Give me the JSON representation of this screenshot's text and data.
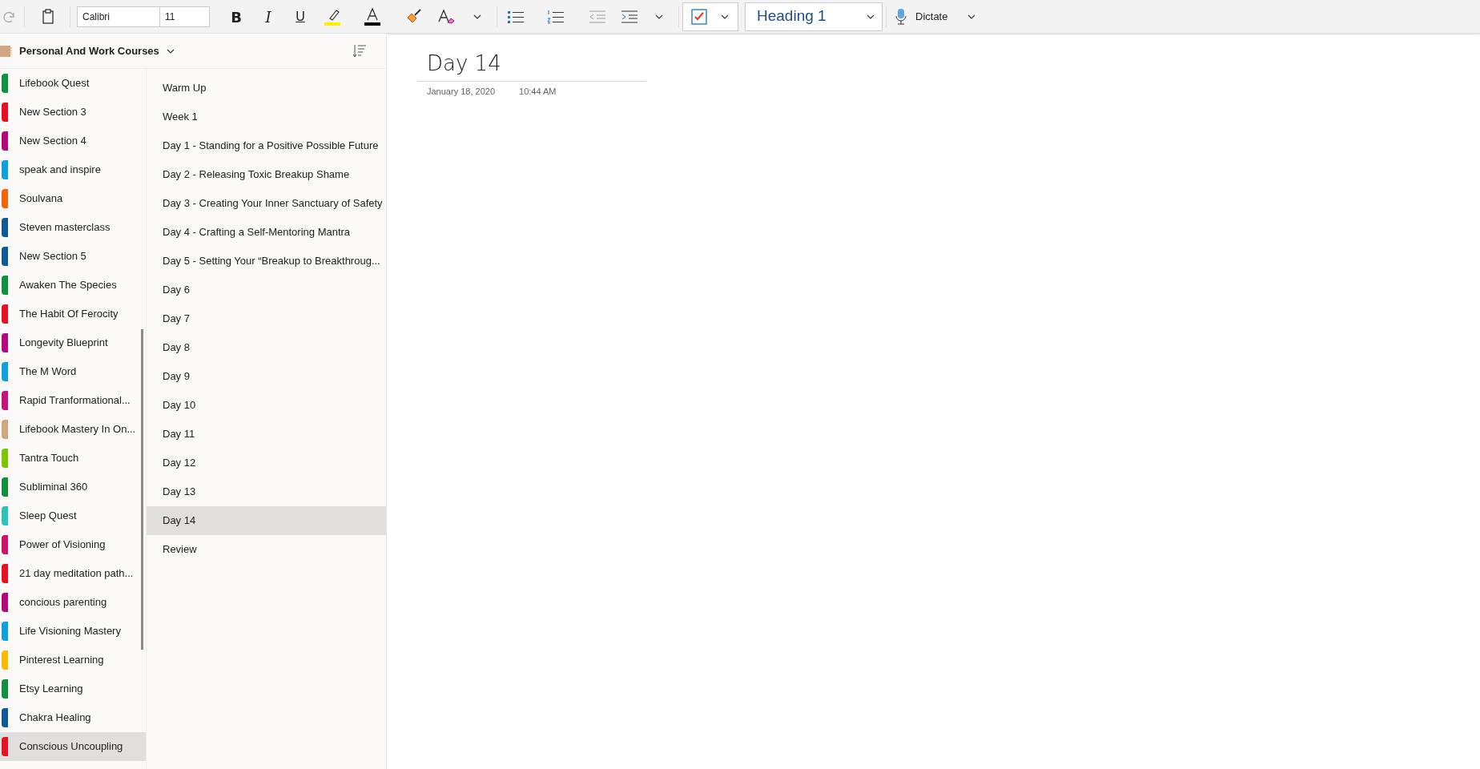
{
  "toolbar": {
    "font": "Calibri",
    "size": "11",
    "bold": "B",
    "italic": "I",
    "underline": "U",
    "style": "Heading 1",
    "dictate": "Dictate",
    "tag_checked": true
  },
  "notebook": {
    "name": "Personal And Work Courses"
  },
  "sections": [
    {
      "name": "Lifebook Quest",
      "color": "#0f9140",
      "selected": false
    },
    {
      "name": "New Section 3",
      "color": "#e81123",
      "selected": false
    },
    {
      "name": "New Section 4",
      "color": "#b4087e",
      "selected": false
    },
    {
      "name": "speak and inspire",
      "color": "#10a0e0",
      "selected": false
    },
    {
      "name": "Soulvana",
      "color": "#f7630c",
      "selected": false
    },
    {
      "name": "Steven masterclass",
      "color": "#0e5a96",
      "selected": false
    },
    {
      "name": "New Section 5",
      "color": "#0e5a96",
      "selected": false
    },
    {
      "name": "Awaken The Species",
      "color": "#0f9140",
      "selected": false
    },
    {
      "name": "The Habit Of Ferocity",
      "color": "#e81123",
      "selected": false
    },
    {
      "name": "Longevity Blueprint",
      "color": "#b4087e",
      "selected": false
    },
    {
      "name": "The M Word",
      "color": "#10a0e0",
      "selected": false
    },
    {
      "name": "Rapid Tranformational...",
      "color": "#c2147a",
      "selected": false
    },
    {
      "name": "Lifebook Mastery In On...",
      "color": "#d2a67e",
      "selected": false
    },
    {
      "name": "Tantra Touch",
      "color": "#7ec600",
      "selected": false
    },
    {
      "name": "Subliminal 360",
      "color": "#0f9140",
      "selected": false
    },
    {
      "name": "Sleep Quest",
      "color": "#2ac4b8",
      "selected": false
    },
    {
      "name": "Power of Visioning",
      "color": "#d0136a",
      "selected": false
    },
    {
      "name": "21 day meditation path...",
      "color": "#e81123",
      "selected": false
    },
    {
      "name": "concious parenting",
      "color": "#b4087e",
      "selected": false
    },
    {
      "name": "Life Visioning Mastery",
      "color": "#10a0e0",
      "selected": false
    },
    {
      "name": "Pinterest Learning",
      "color": "#ffb900",
      "selected": false
    },
    {
      "name": "Etsy Learning",
      "color": "#0f9140",
      "selected": false
    },
    {
      "name": "Chakra Healing",
      "color": "#0e5a96",
      "selected": false
    },
    {
      "name": "Conscious Uncoupling",
      "color": "#e81123",
      "selected": true
    }
  ],
  "pages": [
    {
      "title": "Warm Up",
      "selected": false
    },
    {
      "title": "Week 1",
      "selected": false
    },
    {
      "title": "Day 1 - Standing for a Positive Possible Future",
      "selected": false
    },
    {
      "title": "Day 2 - Releasing Toxic Breakup Shame",
      "selected": false
    },
    {
      "title": "Day 3 - Creating Your Inner Sanctuary of Safety",
      "selected": false
    },
    {
      "title": "Day 4 - Crafting a Self-Mentoring Mantra",
      "selected": false
    },
    {
      "title": "Day 5 - Setting Your “Breakup to Breakthroug...",
      "selected": false
    },
    {
      "title": "Day 6",
      "selected": false
    },
    {
      "title": "Day 7",
      "selected": false
    },
    {
      "title": "Day 8",
      "selected": false
    },
    {
      "title": "Day 9",
      "selected": false
    },
    {
      "title": "Day 10",
      "selected": false
    },
    {
      "title": "Day 11",
      "selected": false
    },
    {
      "title": "Day 12",
      "selected": false
    },
    {
      "title": "Day 13",
      "selected": false
    },
    {
      "title": "Day 14",
      "selected": true
    },
    {
      "title": "Review",
      "selected": false
    }
  ],
  "page": {
    "title": "Day 14",
    "date": "January 18, 2020",
    "time": "10:44 AM"
  }
}
